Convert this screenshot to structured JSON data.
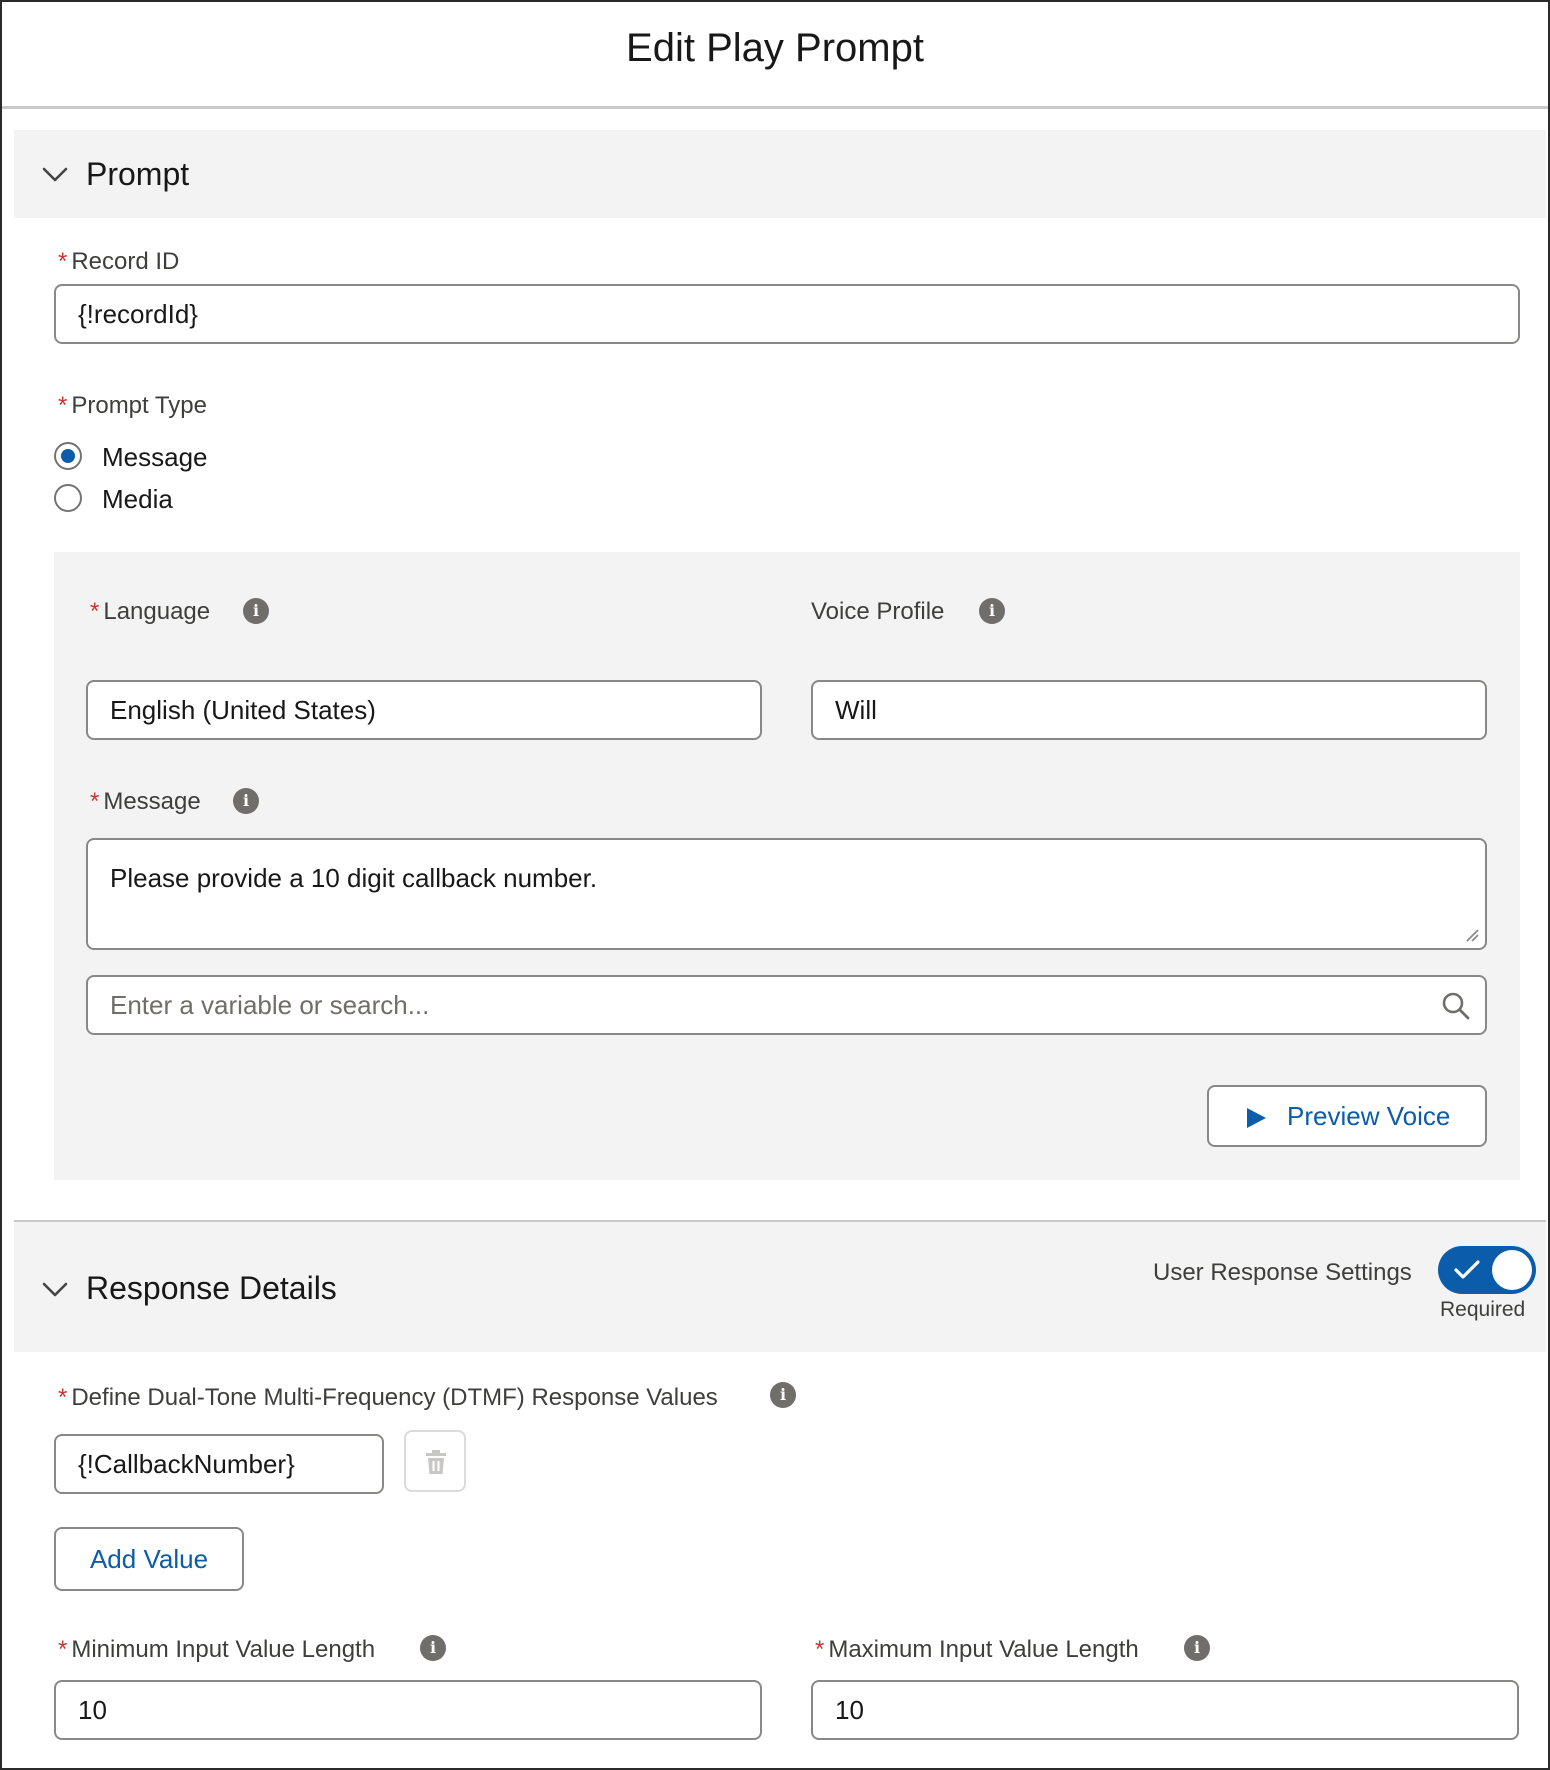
{
  "modal": {
    "title": "Edit Play Prompt"
  },
  "prompt_section": {
    "title": "Prompt",
    "record_id": {
      "label": "Record ID",
      "value": "{!recordId}"
    },
    "prompt_type": {
      "label": "Prompt Type",
      "options": [
        {
          "label": "Message",
          "selected": true
        },
        {
          "label": "Media",
          "selected": false
        }
      ]
    },
    "language": {
      "label": "Language",
      "value": "English (United States)"
    },
    "voice_profile": {
      "label": "Voice Profile",
      "value": "Will"
    },
    "message": {
      "label": "Message",
      "value": "Please provide a 10 digit callback number."
    },
    "variable_search": {
      "placeholder": "Enter a variable or search..."
    },
    "preview_button": {
      "label": "Preview Voice"
    }
  },
  "response_section": {
    "title": "Response Details",
    "user_response_settings": {
      "label": "User Response Settings",
      "state_label": "Required",
      "enabled": true
    },
    "dtmf": {
      "label": "Define Dual-Tone Multi-Frequency (DTMF) Response Values",
      "values": [
        "{!CallbackNumber}"
      ]
    },
    "add_value_button": {
      "label": "Add Value"
    },
    "min_length": {
      "label": "Minimum Input Value Length",
      "value": "10"
    },
    "max_length": {
      "label": "Maximum Input Value Length",
      "value": "10"
    }
  },
  "colors": {
    "brand": "#0b5cab",
    "required": "#c23934",
    "section_bg": "#f3f3f3",
    "border": "#8a8886"
  }
}
